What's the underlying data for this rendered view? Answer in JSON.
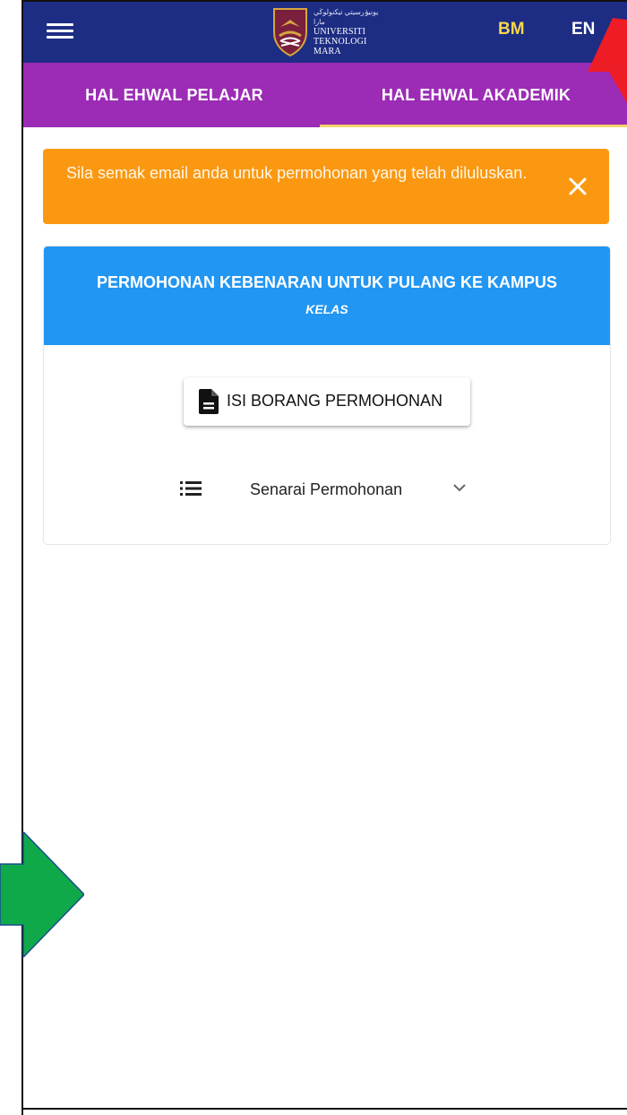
{
  "header": {
    "logo_lines": [
      "UNIVERSITI",
      "TEKNOLOGI",
      "MARA"
    ],
    "logo_jawi": "يونيۏرسيتي تيكنولوڬي مارا",
    "lang_bm": "BM",
    "lang_en": "EN"
  },
  "tabs": [
    {
      "label": "HAL EHWAL PELAJAR"
    },
    {
      "label": "HAL EHWAL AKADEMIK",
      "active": true
    }
  ],
  "alert": {
    "message": "Sila semak email anda untuk permohonan yang telah diluluskan.",
    "close_icon": "close-icon"
  },
  "card": {
    "title": "PERMOHONAN KEBENARAN UNTUK PULANG KE KAMPUS",
    "subtitle": "KELAS",
    "fill_button_label": "ISI BORANG PERMOHONAN",
    "list_label": "Senarai Permohonan"
  },
  "colors": {
    "appbar": "#1d2d84",
    "tabbar": "#9c2bb6",
    "tab_indicator": "#f5d36b",
    "alert": "#fb9812",
    "card_header": "#2196f3",
    "lang_active": "#f7d64a",
    "annotation_red": "#ee1c25",
    "annotation_green": "#0fa94a"
  }
}
